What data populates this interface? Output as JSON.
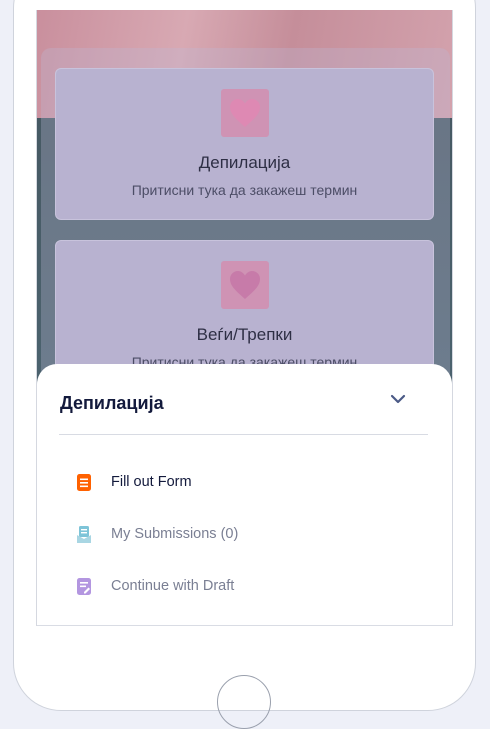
{
  "cards": [
    {
      "title": "Депилација",
      "subtitle": "Притисни тука да закажеш термин"
    },
    {
      "title": "Веѓи/Трепки",
      "subtitle": "Притисни тука да закажеш термин"
    }
  ],
  "sheet": {
    "title": "Депилација",
    "items": [
      {
        "label": "Fill out Form",
        "icon": "form-icon",
        "color": "#ff6100"
      },
      {
        "label": "My Submissions (0)",
        "icon": "submissions-icon",
        "color": "#7ec4d8"
      },
      {
        "label": "Continue with Draft",
        "icon": "draft-icon",
        "color": "#b396e0"
      }
    ]
  }
}
